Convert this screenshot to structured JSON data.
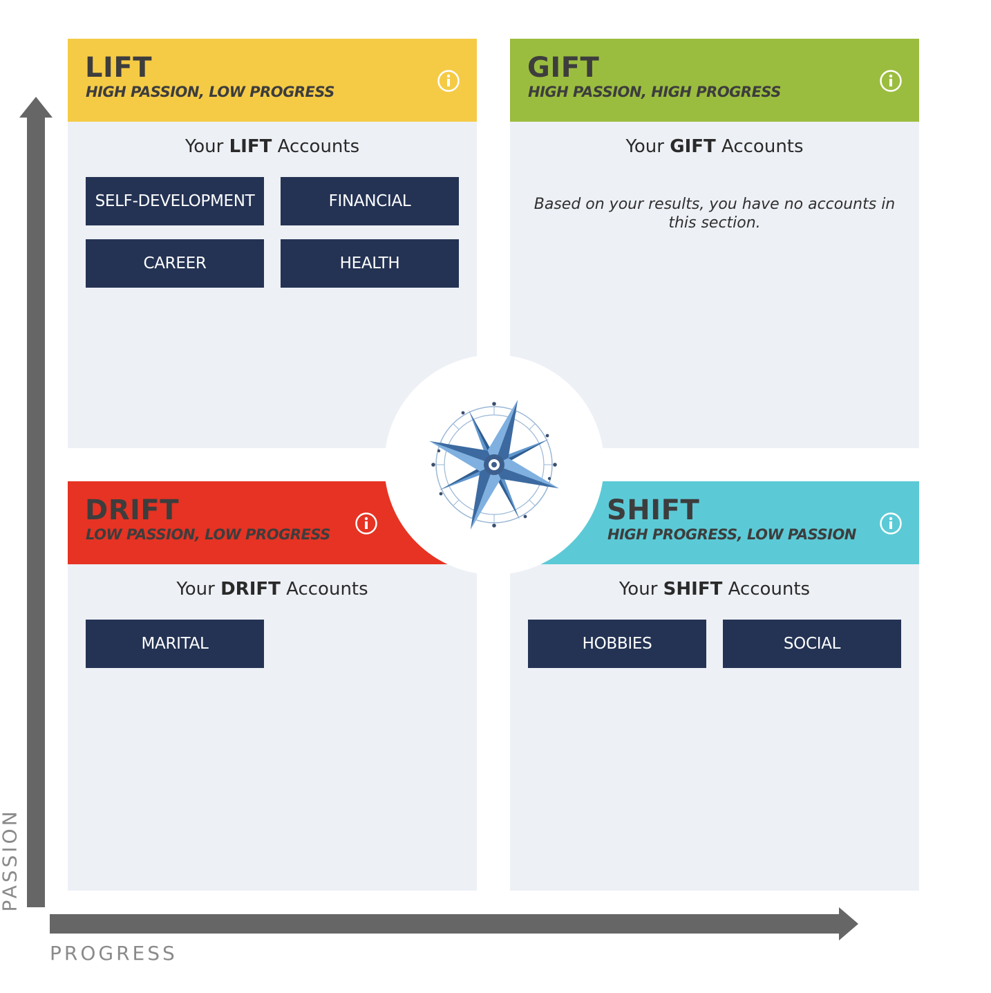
{
  "quadrants": {
    "lift": {
      "title": "LIFT",
      "subtitle": "HIGH PASSION, LOW PROGRESS",
      "color": "#f5cb46",
      "label_pre": "Your ",
      "label_bold": "LIFT",
      "label_post": " Accounts",
      "accounts": [
        "SELF-DEVELOPMENT",
        "FINANCIAL",
        "CAREER",
        "HEALTH"
      ]
    },
    "gift": {
      "title": "GIFT",
      "subtitle": "HIGH PASSION, HIGH PROGRESS",
      "color": "#9bbd3f",
      "label_pre": "Your ",
      "label_bold": "GIFT",
      "label_post": " Accounts",
      "empty_message": "Based on your results, you have no accounts in this section."
    },
    "drift": {
      "title": "DRIFT",
      "subtitle": "LOW PASSION, LOW PROGRESS",
      "color": "#e63323",
      "label_pre": "Your ",
      "label_bold": "DRIFT",
      "label_post": " Accounts",
      "accounts": [
        "MARITAL"
      ]
    },
    "shift": {
      "title": "SHIFT",
      "subtitle": "HIGH PROGRESS, LOW PASSION",
      "color": "#5bcad6",
      "label_pre": "Your ",
      "label_bold": "SHIFT",
      "label_post": " Accounts",
      "accounts": [
        "HOBBIES",
        "SOCIAL"
      ]
    }
  },
  "axes": {
    "y_label": "PASSION",
    "x_label": "PROGRESS",
    "color": "#666666"
  },
  "icons": {
    "info": "info-icon",
    "center": "compass-rose-icon"
  },
  "colors": {
    "account_button": "#243354",
    "panel_bg": "#edf0f5",
    "compass_light": "#7fb0e0",
    "compass_dark": "#3c6aa0"
  }
}
